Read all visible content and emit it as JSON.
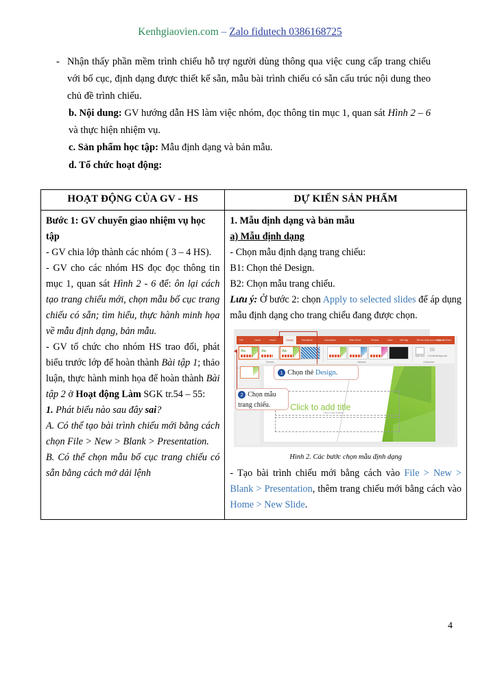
{
  "header": {
    "brand": "Kenhgiaovien.com",
    "separator": " – ",
    "contact": "Zalo fidutech 0386168725"
  },
  "intro": {
    "bullet_marker": "-",
    "bullet_text": "Nhận thấy phần mềm trình chiếu hỗ trợ người dùng thông qua việc cung cấp trang chiếu với bố cục, định dạng được thiết kế sẵn, mẫu bài trình chiếu có sẵn cấu trúc nội dung theo chủ đề trình chiếu.",
    "b_label": "b. Nội dung:",
    "b_text_1": " GV hướng dẫn HS làm việc nhóm, đọc thông tin mục 1, quan sát ",
    "b_text_italic": "Hình 2 – 6",
    "b_text_2": " và thực hiện nhiệm vụ.",
    "c_label": "c. Sản phẩm học tập:",
    "c_text": " Mẫu định dạng và bản mẫu.",
    "d_label": "d. Tổ chức hoạt động:"
  },
  "table": {
    "headers": [
      "HOẠT ĐỘNG CỦA GV - HS",
      "DỰ KIẾN SẢN PHẨM"
    ],
    "left": {
      "step_title": "Bước 1: GV chuyển giao nhiệm vụ học tập",
      "p1": "- GV chia lớp thành các nhóm ( 3 – 4 HS).",
      "p2_a": "- GV cho các nhóm HS đọc đọc thông tin mục 1, quan sát ",
      "p2_fig": "Hình 2 - 6",
      "p2_b": " để: ",
      "p2_italic": "ôn lại cách tạo trang chiếu mới, chọn mẫu bố cục trang chiếu có sẵn; tìm hiểu, thực hành minh họa về mẫu định dạng, bản mẫu.",
      "p3_a": "- GV tổ chức cho nhóm HS trao đổi, phát biểu trước lớp để hoàn thành ",
      "p3_it1": "Bài tập 1",
      "p3_b": "; thảo luận, thực hành minh họa để hoàn thành ",
      "p3_it2": "Bài tập 2",
      "p3_c": " ở ",
      "p3_bold": "Hoạt động Làm",
      "p3_d": " SGK tr.54 – 55:",
      "q_num": "1.",
      "q_text": " Phát biểu nào sau đây ",
      "q_bold": "sai",
      "q_end": "?",
      "opt_a": "A. Có thể tạo bài trình chiếu mới bằng cách chọn File > New > Blank > Presentation.",
      "opt_b": "B. Có thể chọn mẫu bố cục trang chiếu có sẵn bằng cách mở dải lệnh"
    },
    "right": {
      "h1": "1. Mẫu định dạng và bản mẫu",
      "h2": "a) Mẫu định dạng",
      "p1": "- Chọn mẫu định dạng trang chiếu:",
      "p2": "B1: Chọn thẻ Design.",
      "p3": "B2: Chọn mẫu trang chiếu.",
      "note_label": "Lưu ý:",
      "note_a": " Ở bước 2: chọn ",
      "note_link": "Apply to selected slides",
      "note_b": " để áp dụng mẫu định dạng cho trang chiếu đang được chọn.",
      "caption": "Hình 2. Các bước chọn mẫu định dạng",
      "last_a": "- Tạo bài trình chiếu mới bằng cách vào ",
      "last_link1": "File > New > Blank > Presentation",
      "last_b": ", thêm trang chiếu mới bằng cách vào ",
      "last_link2": "Home > New Slide",
      "last_c": "."
    }
  },
  "figure": {
    "ribbon_tabs": [
      "File",
      "Home",
      "Insert",
      "Design",
      "Transitions",
      "Animations",
      "Slide Show",
      "Review",
      "View",
      "Mix Mgr",
      "Tell me what you want to do",
      "Sign in",
      "Share"
    ],
    "active_tab": "Design",
    "group_labels": [
      "Themes",
      "Variants",
      "Customize"
    ],
    "slide_number": "1",
    "slide_title_placeholder": "Click to add title",
    "slide_subtitle_placeholder": "Click to add subtitle",
    "callout_1_num": "1",
    "callout_1_text_a": "Chọn thẻ ",
    "callout_1_text_b": "Design",
    "callout_1_text_c": ".",
    "callout_2_num": "2",
    "callout_2_text": "Chọn mẫu trang chiếu.",
    "size_label": "Sli",
    "slide_size_lbl": "Slide Size",
    "format_bg_lbl": "Format Background"
  },
  "page_number": "4",
  "colors": {
    "brand_green": "#2e8b57",
    "link_blue": "#2a3f9d",
    "inline_blue": "#3b78b5",
    "ppt_orange": "#d04a28",
    "facet_green": "#8cc63f",
    "callout_border": "#e0a79a",
    "arrow_red": "#c0392b"
  }
}
